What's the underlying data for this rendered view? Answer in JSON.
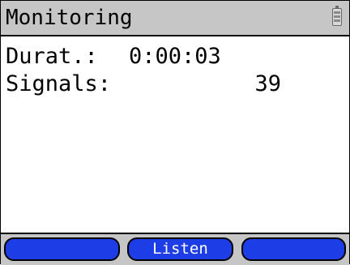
{
  "header": {
    "title": "Monitoring",
    "status_icon": "battery-icon"
  },
  "main": {
    "rows": [
      {
        "label": "Durat.:",
        "value": "0:00:03"
      },
      {
        "label": "Signals:",
        "value": "39"
      }
    ]
  },
  "softkeys": {
    "left_label": "",
    "center_label": "Listen",
    "right_label": ""
  },
  "colors": {
    "titlebar": "#c6c6c6",
    "softkey": "#1d3ee6",
    "softkey_text": "#ffffff"
  }
}
